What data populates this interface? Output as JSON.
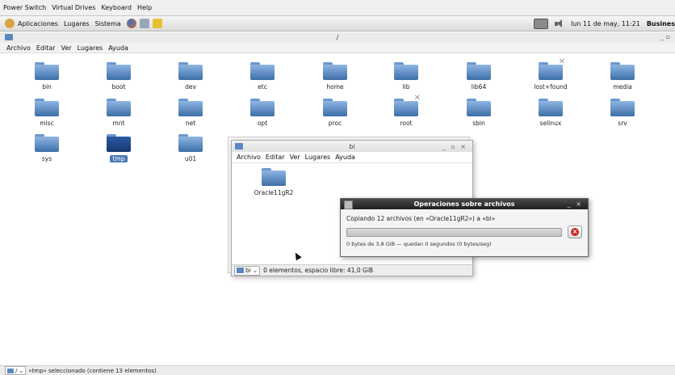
{
  "host_menu": [
    "Power Switch",
    "Virtual Drives",
    "Keyboard",
    "Help"
  ],
  "panel": {
    "items": [
      "Aplicaciones",
      "Lugares",
      "Sistema"
    ],
    "clock": "lun 11 de may, 11:21",
    "truncated_right": "Busines"
  },
  "main_window": {
    "title": "/",
    "controls": "_ ▫",
    "menu": [
      "Archivo",
      "Editar",
      "Ver",
      "Lugares",
      "Ayuda"
    ]
  },
  "folders": [
    {
      "label": "bin"
    },
    {
      "label": "boot"
    },
    {
      "label": "dev"
    },
    {
      "label": "etc"
    },
    {
      "label": "home"
    },
    {
      "label": "lib"
    },
    {
      "label": "lib64"
    },
    {
      "label": "lost+found",
      "locked": true
    },
    {
      "label": "media"
    },
    {
      "label": "misc"
    },
    {
      "label": "mnt"
    },
    {
      "label": "net"
    },
    {
      "label": "opt"
    },
    {
      "label": "proc"
    },
    {
      "label": "root",
      "locked": true
    },
    {
      "label": "sbin"
    },
    {
      "label": "selinux"
    },
    {
      "label": "srv"
    },
    {
      "label": "sys"
    },
    {
      "label": "tmp",
      "selected": true
    },
    {
      "label": "u01"
    }
  ],
  "bi_window": {
    "title": "bi",
    "controls": "_ ▫ ×",
    "menu": [
      "Archivo",
      "Editar",
      "Ver",
      "Lugares",
      "Ayuda"
    ],
    "folder_label": "Oracle11gR2",
    "path_label": "bi",
    "status": "0 elementos, espacio libre: 41,0 GiB"
  },
  "file_ops": {
    "title": "Operaciones sobre archivos",
    "controls": "_ ×",
    "copy_text": "Copiando 12 archivos (en «Oracle11gR2») a «bi»",
    "progress_fraction": 0.0,
    "detail_text": "0 bytes de 3,8 GiB — quedan 0 segundos (0 bytes/seg)",
    "cancel_glyph": "×"
  },
  "statusbar": {
    "path_label": "/",
    "info": "«tmp» seleccionado (contiene 13 elementos)"
  },
  "colors": {
    "folder_blue": "#5b87c0",
    "selection": "#4a78b8",
    "cancel_red": "#c62828"
  }
}
